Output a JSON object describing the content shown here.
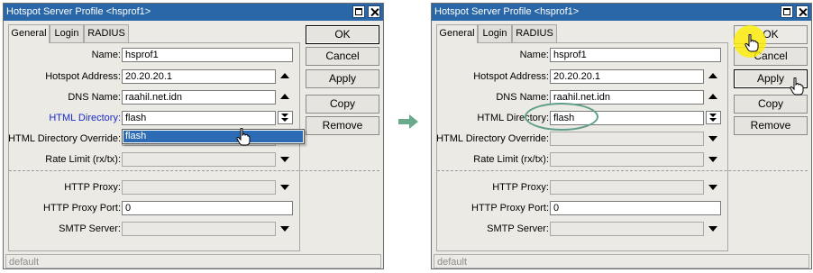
{
  "left_window": {
    "title": "Hotspot Server Profile <hsprof1>",
    "tabs": [
      "General",
      "Login",
      "RADIUS"
    ],
    "fields": {
      "name": {
        "label": "Name:",
        "value": "hsprof1"
      },
      "hotspot_address": {
        "label": "Hotspot Address:",
        "value": "20.20.20.1"
      },
      "dns_name": {
        "label": "DNS Name:",
        "value": "raahil.net.idn"
      },
      "html_directory": {
        "label": "HTML Directory:",
        "value": "flash"
      },
      "html_directory_override": {
        "label": "HTML Directory Override:",
        "value": ""
      },
      "rate_limit": {
        "label": "Rate Limit (rx/tx):",
        "value": ""
      },
      "http_proxy": {
        "label": "HTTP Proxy:",
        "value": ""
      },
      "http_proxy_port": {
        "label": "HTTP Proxy Port:",
        "value": "0"
      },
      "smtp_server": {
        "label": "SMTP Server:",
        "value": ""
      }
    },
    "dropdown_option": "flash",
    "buttons": [
      "OK",
      "Cancel",
      "Apply",
      "Copy",
      "Remove"
    ],
    "status": "default"
  },
  "right_window": {
    "title": "Hotspot Server Profile <hsprof1>",
    "tabs": [
      "General",
      "Login",
      "RADIUS"
    ],
    "fields": {
      "name": {
        "label": "Name:",
        "value": "hsprof1"
      },
      "hotspot_address": {
        "label": "Hotspot Address:",
        "value": "20.20.20.1"
      },
      "dns_name": {
        "label": "DNS Name:",
        "value": "raahil.net.idn"
      },
      "html_directory": {
        "label": "HTML Directory:",
        "value": "flash"
      },
      "html_directory_override": {
        "label": "HTML Directory Override:",
        "value": ""
      },
      "rate_limit": {
        "label": "Rate Limit (rx/tx):",
        "value": ""
      },
      "http_proxy": {
        "label": "HTTP Proxy:",
        "value": ""
      },
      "http_proxy_port": {
        "label": "HTTP Proxy Port:",
        "value": "0"
      },
      "smtp_server": {
        "label": "SMTP Server:",
        "value": ""
      }
    },
    "buttons": [
      "OK",
      "Cancel",
      "Apply",
      "Copy",
      "Remove"
    ],
    "status": "default"
  },
  "icons": {
    "window_maximize": "maximize-icon",
    "window_close": "close-icon",
    "step_arrow": "right-arrow-icon",
    "pointer": "hand-cursor-icon"
  },
  "colors": {
    "titlebar": "#2a67a8",
    "link_label": "#1a2bc7",
    "selection": "#2d6bb5",
    "highlight_ellipse": "#5e9e8a",
    "click_marker": "#ffee00",
    "step_arrow": "#6aa88c"
  }
}
